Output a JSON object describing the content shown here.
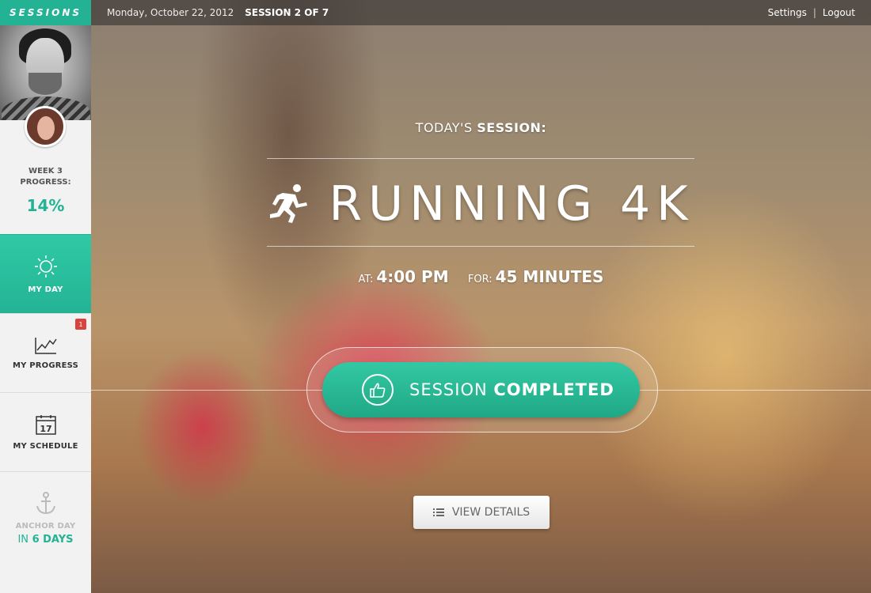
{
  "app": {
    "logo": "SESSIONS"
  },
  "topbar": {
    "date": "Monday, October 22, 2012",
    "session_count": "SESSION 2 OF 7",
    "settings": "Settings",
    "separator": "|",
    "logout": "Logout"
  },
  "sidebar": {
    "progress_label_line1": "WEEK 3",
    "progress_label_line2": "PROGRESS:",
    "progress_value": "14%",
    "nav": [
      {
        "label": "MY DAY",
        "icon": "sun-icon",
        "active": true
      },
      {
        "label": "MY PROGRESS",
        "icon": "chart-icon",
        "badge": "1"
      },
      {
        "label": "MY SCHEDULE",
        "icon": "calendar-icon",
        "calendar_day": "17"
      }
    ],
    "anchor": {
      "label": "ANCHOR DAY",
      "prefix": "IN",
      "value": "6 DAYS",
      "icon": "anchor-icon"
    }
  },
  "session": {
    "heading_light": "TODAY'S",
    "heading_bold": "SESSION:",
    "title": "RUNNING 4K",
    "at_label": "AT:",
    "at_value": "4:00 PM",
    "for_label": "FOR:",
    "for_value": "45 MINUTES",
    "complete_light": "SESSION",
    "complete_bold": "COMPLETED",
    "details_label": "VIEW DETAILS"
  },
  "colors": {
    "accent": "#23b394",
    "badge": "#d9433e"
  }
}
